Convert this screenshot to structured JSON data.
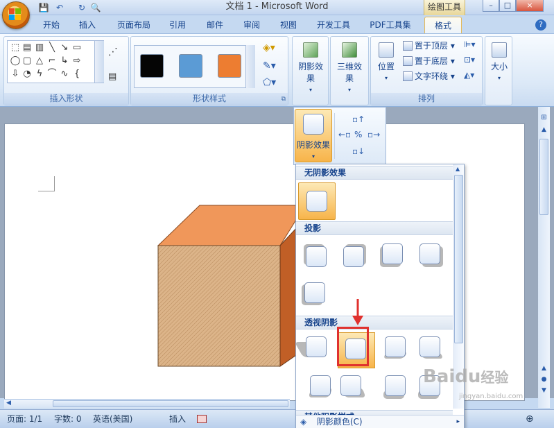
{
  "window": {
    "title": "文档 1 - Microsoft Word",
    "context_tool": "绘图工具",
    "controls": [
      "–",
      "□",
      "×"
    ]
  },
  "quick_access": [
    "💾",
    "↶",
    "↻",
    "🔍"
  ],
  "tabs": [
    "开始",
    "插入",
    "页面布局",
    "引用",
    "邮件",
    "审阅",
    "视图",
    "开发工具",
    "PDF工具集",
    "格式"
  ],
  "active_tab": "格式",
  "ribbon": {
    "groups": {
      "insert_shapes": "插入形状",
      "shape_styles": "形状样式",
      "arrange": "排列"
    },
    "shadow_effect": "阴影效果",
    "threed_effect": "三维效果",
    "position": "位置",
    "bring_front": "置于顶层",
    "send_back": "置于底层",
    "text_wrap": "文字环绕",
    "size": "大小",
    "swatch_colors": [
      "#050505",
      "#5b9bd5",
      "#ed7d31"
    ]
  },
  "dropdown": {
    "sections": [
      "无阴影效果",
      "投影",
      "透视阴影",
      "其他阴影样式"
    ],
    "shadow_color": "阴影颜色(C)"
  },
  "status": {
    "page": "页面: 1/1",
    "words": "字数: 0",
    "language": "英语(美国)",
    "mode": "插入"
  },
  "watermark": {
    "brand": "Baidu",
    "sub": "经验",
    "url": "jingyan.baidu.com"
  },
  "colors": {
    "cube_top": "#f0975a",
    "cube_front": "#d4a87a",
    "cube_side": "#c15f26",
    "highlight": "#e0312e"
  }
}
